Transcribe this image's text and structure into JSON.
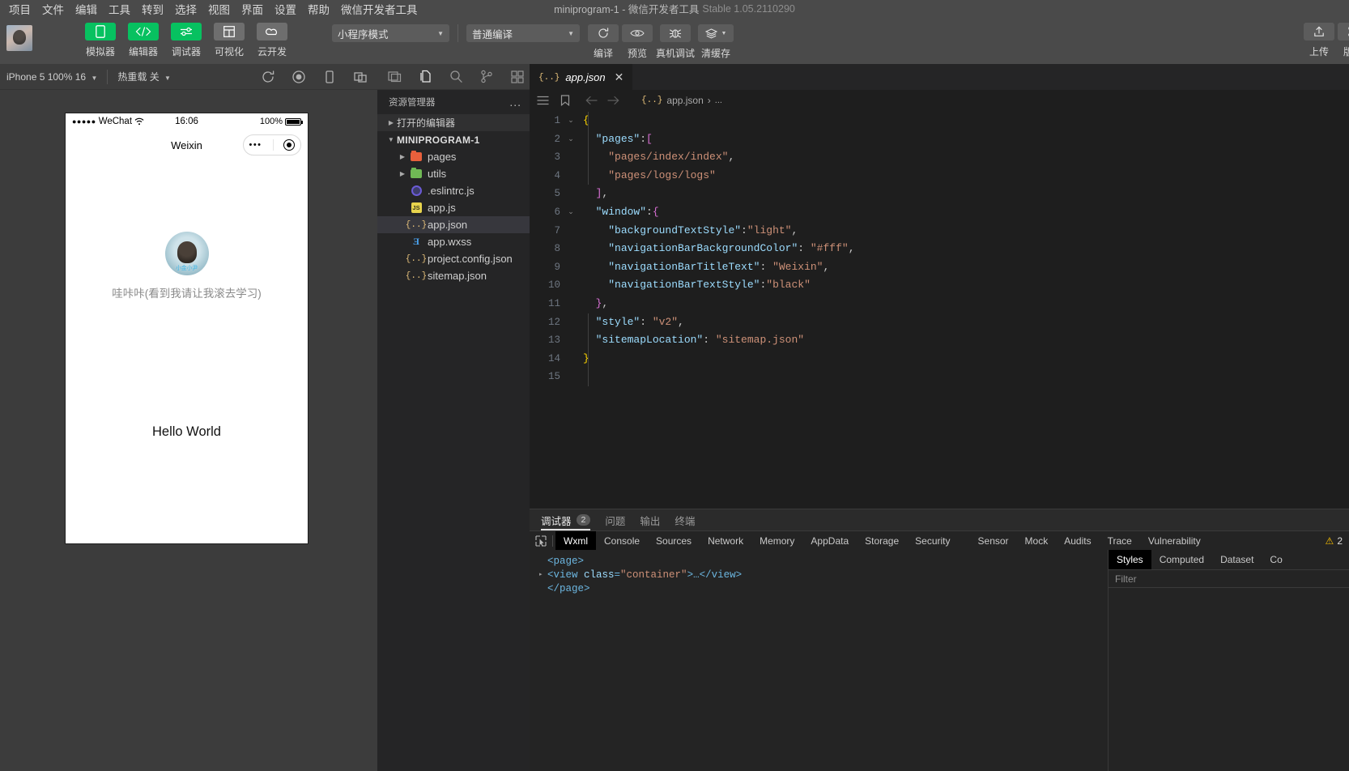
{
  "titlebar": {
    "project": "miniprogram-1",
    "dash": "-",
    "app": "微信开发者工具",
    "version": "Stable 1.05.2110290"
  },
  "menu": {
    "items": [
      "项目",
      "文件",
      "编辑",
      "工具",
      "转到",
      "选择",
      "视图",
      "界面",
      "设置",
      "帮助",
      "微信开发者工具"
    ]
  },
  "toolbar": {
    "tools": [
      {
        "label": "模拟器",
        "icon": "phone-icon",
        "style": "green"
      },
      {
        "label": "编辑器",
        "icon": "code-icon",
        "style": "green"
      },
      {
        "label": "调试器",
        "icon": "sliders-icon",
        "style": "green"
      },
      {
        "label": "可视化",
        "icon": "layout-icon",
        "style": "grey"
      },
      {
        "label": "云开发",
        "icon": "cloud-icon",
        "style": "grey"
      }
    ],
    "mode_select": "小程序模式",
    "compile_select": "普通编译",
    "compile_buttons": [
      {
        "label": "编译",
        "icon": "refresh-icon"
      },
      {
        "label": "预览",
        "icon": "eye-icon"
      },
      {
        "label": "真机调试",
        "icon": "bug-icon"
      },
      {
        "label": "清缓存",
        "icon": "layers-icon"
      }
    ],
    "right_buttons": [
      {
        "label": "上传",
        "icon": "upload-icon"
      },
      {
        "label": "版本",
        "icon": "version-icon"
      }
    ]
  },
  "simulator": {
    "device_select": "iPhone 5 100% 16",
    "hotreload_select": "热重载 关",
    "icons": [
      "refresh-icon",
      "record-icon",
      "rotate-device-icon",
      "split-screen-icon"
    ],
    "phone": {
      "carrier": "WeChat",
      "signal_dots": "●●●●●",
      "time": "16:06",
      "battery_percent": "100%",
      "nav_title": "Weixin",
      "capsule_dots": "•••",
      "user_name": "哇咔咔(看到我请让我滚去学习)",
      "avatar_label": "小金小尹",
      "content_text": "Hello World"
    }
  },
  "activity_bar": {
    "icons": [
      "screen-layout-icon",
      "files-explorer-icon",
      "search-icon",
      "source-control-icon",
      "extensions-icon",
      "outline-icon",
      "debug-icon"
    ]
  },
  "explorer": {
    "title": "资源管理器",
    "more": "...",
    "open_editors": "打开的编辑器",
    "root": "MINIPROGRAM-1",
    "files": [
      {
        "name": "pages",
        "type": "folder",
        "color": "#e8603c",
        "expanded": false
      },
      {
        "name": "utils",
        "type": "folder",
        "color": "#70b955",
        "expanded": false
      },
      {
        "name": ".eslintrc.js",
        "type": "eslint",
        "selected": false
      },
      {
        "name": "app.js",
        "type": "js",
        "selected": false
      },
      {
        "name": "app.json",
        "type": "json",
        "selected": true
      },
      {
        "name": "app.wxss",
        "type": "wxss",
        "selected": false
      },
      {
        "name": "project.config.json",
        "type": "json",
        "selected": false
      },
      {
        "name": "sitemap.json",
        "type": "json",
        "selected": false
      }
    ]
  },
  "editor": {
    "tab": {
      "name": "app.json",
      "icon": "json-icon",
      "close": "✕"
    },
    "breadcrumb": {
      "icons": [
        "outline-icon",
        "bookmark-icon",
        "back-arrow-icon",
        "forward-arrow-icon"
      ],
      "file": "app.json",
      "sep": "›",
      "tail": "..."
    },
    "lines": [
      {
        "n": 1,
        "fold": "v",
        "tokens": [
          {
            "t": "{",
            "c": "br1"
          }
        ]
      },
      {
        "n": 2,
        "fold": "v",
        "tokens": [
          {
            "t": "  ",
            "c": "p"
          },
          {
            "t": "\"pages\"",
            "c": "k"
          },
          {
            "t": ":",
            "c": "p"
          },
          {
            "t": "[",
            "c": "br2"
          }
        ]
      },
      {
        "n": 3,
        "fold": "",
        "tokens": [
          {
            "t": "    ",
            "c": "p"
          },
          {
            "t": "\"pages/index/index\"",
            "c": "s"
          },
          {
            "t": ",",
            "c": "p"
          }
        ]
      },
      {
        "n": 4,
        "fold": "",
        "tokens": [
          {
            "t": "    ",
            "c": "p"
          },
          {
            "t": "\"pages/logs/logs\"",
            "c": "s"
          }
        ]
      },
      {
        "n": 5,
        "fold": "",
        "tokens": [
          {
            "t": "  ",
            "c": "p"
          },
          {
            "t": "]",
            "c": "br2"
          },
          {
            "t": ",",
            "c": "p"
          }
        ]
      },
      {
        "n": 6,
        "fold": "v",
        "tokens": [
          {
            "t": "  ",
            "c": "p"
          },
          {
            "t": "\"window\"",
            "c": "k"
          },
          {
            "t": ":",
            "c": "p"
          },
          {
            "t": "{",
            "c": "br2"
          }
        ]
      },
      {
        "n": 7,
        "fold": "",
        "tokens": [
          {
            "t": "    ",
            "c": "p"
          },
          {
            "t": "\"backgroundTextStyle\"",
            "c": "k"
          },
          {
            "t": ":",
            "c": "p"
          },
          {
            "t": "\"light\"",
            "c": "s"
          },
          {
            "t": ",",
            "c": "p"
          }
        ]
      },
      {
        "n": 8,
        "fold": "",
        "tokens": [
          {
            "t": "    ",
            "c": "p"
          },
          {
            "t": "\"navigationBarBackgroundColor\"",
            "c": "k"
          },
          {
            "t": ": ",
            "c": "p"
          },
          {
            "t": "\"#fff\"",
            "c": "s"
          },
          {
            "t": ",",
            "c": "p"
          }
        ]
      },
      {
        "n": 9,
        "fold": "",
        "tokens": [
          {
            "t": "    ",
            "c": "p"
          },
          {
            "t": "\"navigationBarTitleText\"",
            "c": "k"
          },
          {
            "t": ": ",
            "c": "p"
          },
          {
            "t": "\"Weixin\"",
            "c": "s"
          },
          {
            "t": ",",
            "c": "p"
          }
        ]
      },
      {
        "n": 10,
        "fold": "",
        "tokens": [
          {
            "t": "    ",
            "c": "p"
          },
          {
            "t": "\"navigationBarTextStyle\"",
            "c": "k"
          },
          {
            "t": ":",
            "c": "p"
          },
          {
            "t": "\"black\"",
            "c": "s"
          }
        ]
      },
      {
        "n": 11,
        "fold": "",
        "tokens": [
          {
            "t": "  ",
            "c": "p"
          },
          {
            "t": "}",
            "c": "br2"
          },
          {
            "t": ",",
            "c": "p"
          }
        ]
      },
      {
        "n": 12,
        "fold": "",
        "tokens": [
          {
            "t": "  ",
            "c": "p"
          },
          {
            "t": "\"style\"",
            "c": "k"
          },
          {
            "t": ": ",
            "c": "p"
          },
          {
            "t": "\"v2\"",
            "c": "s"
          },
          {
            "t": ",",
            "c": "p"
          }
        ]
      },
      {
        "n": 13,
        "fold": "",
        "tokens": [
          {
            "t": "  ",
            "c": "p"
          },
          {
            "t": "\"sitemapLocation\"",
            "c": "k"
          },
          {
            "t": ": ",
            "c": "p"
          },
          {
            "t": "\"sitemap.json\"",
            "c": "s"
          }
        ]
      },
      {
        "n": 14,
        "fold": "",
        "tokens": [
          {
            "t": "}",
            "c": "br1"
          }
        ]
      },
      {
        "n": 15,
        "fold": "",
        "tokens": []
      }
    ]
  },
  "debugger": {
    "panel_tabs": [
      {
        "label": "调试器",
        "badge": "2",
        "active": true
      },
      {
        "label": "问题",
        "badge": "",
        "active": false
      },
      {
        "label": "输出",
        "badge": "",
        "active": false
      },
      {
        "label": "终端",
        "badge": "",
        "active": false
      }
    ],
    "devtools_tabs": [
      "Wxml",
      "Console",
      "Sources",
      "Network",
      "Memory",
      "AppData",
      "Storage",
      "Security",
      "Sensor",
      "Mock",
      "Audits",
      "Trace",
      "Vulnerability"
    ],
    "active_devtools_tab": "Wxml",
    "warning_icon": "warning-triangle-icon",
    "warning_count": "2",
    "wxml": [
      {
        "indent": 0,
        "arrow": "",
        "parts": [
          {
            "t": "<page>",
            "c": "tagc"
          }
        ]
      },
      {
        "indent": 0,
        "arrow": "▸",
        "parts": [
          {
            "t": "<view ",
            "c": "tagc"
          },
          {
            "t": "class",
            "c": "attrc"
          },
          {
            "t": "=",
            "c": "tagc"
          },
          {
            "t": "\"container\"",
            "c": "valc"
          },
          {
            "t": ">…</view>",
            "c": "tagc"
          }
        ]
      },
      {
        "indent": 0,
        "arrow": "",
        "parts": [
          {
            "t": "</page>",
            "c": "tagc"
          }
        ]
      }
    ],
    "styles_tabs": [
      "Styles",
      "Computed",
      "Dataset",
      "Co"
    ],
    "active_styles_tab": "Styles",
    "filter_placeholder": "Filter"
  }
}
